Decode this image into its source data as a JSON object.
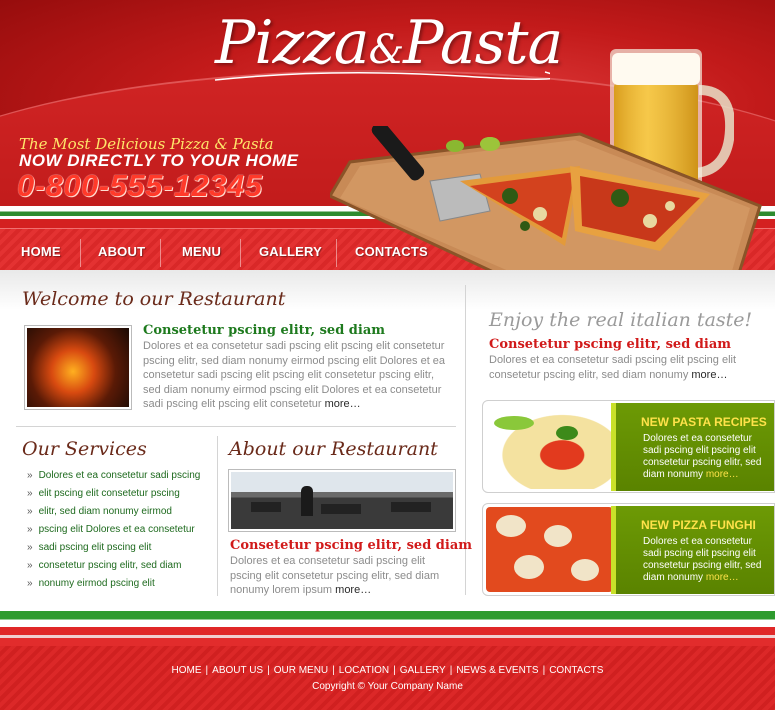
{
  "header": {
    "logo_left": "Pizza",
    "logo_amp": "&",
    "logo_right": "Pasta",
    "tagline": "The Most Delicious Pizza & Pasta",
    "subline": "NOW DIRECTLY TO YOUR HOME",
    "phone": "0-800-555-12345"
  },
  "nav": {
    "items": [
      {
        "label": "HOME"
      },
      {
        "label": "ABOUT"
      },
      {
        "label": "MENU"
      },
      {
        "label": "GALLERY"
      },
      {
        "label": "CONTACTS"
      }
    ]
  },
  "welcome": {
    "title": "Welcome to our Restaurant",
    "heading": "Consetetur pscing elitr, sed diam",
    "text": "Dolores et ea consetetur sadi pscing elit pscing elit consetetur pscing elitr, sed diam nonumy eirmod  pscing elit Dolores et ea consetetur sadi pscing elit pscing elit consetetur pscing elitr, sed diam nonumy eirmod  pscing elit Dolores et ea consetetur sadi pscing elit pscing elit consetetur",
    "more": "more…"
  },
  "services": {
    "title": "Our Services",
    "items": [
      "Dolores et ea consetetur sadi pscing",
      "elit pscing elit consetetur pscing",
      "elitr, sed diam nonumy eirmod",
      "pscing elit Dolores et ea consetetur",
      "sadi pscing elit pscing elit",
      "consetetur pscing elitr, sed diam",
      "nonumy eirmod  pscing elit"
    ],
    "bullet": "»"
  },
  "about": {
    "title": "About our Restaurant",
    "heading": "Consetetur pscing elitr, sed diam",
    "text": "Dolores et ea consetetur sadi pscing elit pscing elit consetetur pscing elitr, sed diam nonumy lorem ipsum",
    "more": "more…"
  },
  "italian": {
    "title": "Enjoy the real italian taste!",
    "heading": "Consetetur pscing elitr, sed diam",
    "text": "Dolores et ea consetetur sadi pscing elit pscing elit consetetur pscing elitr, sed diam nonumy",
    "more": "more…"
  },
  "promos": [
    {
      "title": "NEW PASTA RECIPES",
      "text": "Dolores et ea consetetur sadi pscing elit pscing elit consetetur pscing elitr, sed diam nonumy",
      "more": "more…"
    },
    {
      "title": "NEW PIZZA FUNGHI",
      "text": "Dolores et ea consetetur sadi pscing elit pscing elit consetetur pscing elitr, sed diam nonumy",
      "more": "more…"
    }
  ],
  "footer": {
    "links": [
      "HOME",
      "ABOUT US",
      "OUR MENU",
      "LOCATION",
      "GALLERY",
      "NEWS & EVENTS",
      "CONTACTS"
    ],
    "separator": "|",
    "copyright": "Copyright © Your Company Name"
  },
  "colors": {
    "brand_red": "#c21a1a",
    "phone_red": "#ff3a2a",
    "tagline_yellow": "#ffe66a",
    "heading_red": "#d11a1a",
    "service_green": "#1e6a1e",
    "promo_green": "#5a8300",
    "promo_yellow": "#ffe24a",
    "title_brown": "#6a2a1a"
  }
}
